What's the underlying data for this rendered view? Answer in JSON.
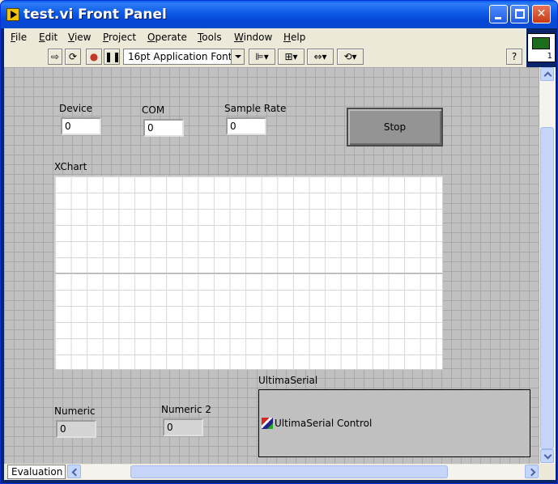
{
  "window": {
    "title": "test.vi Front Panel"
  },
  "menu": {
    "items": [
      {
        "first": "F",
        "rest": "ile"
      },
      {
        "first": "E",
        "rest": "dit"
      },
      {
        "first": "V",
        "rest": "iew"
      },
      {
        "first": "P",
        "rest": "roject"
      },
      {
        "first": "O",
        "rest": "perate"
      },
      {
        "first": "T",
        "rest": "ools"
      },
      {
        "first": "W",
        "rest": "indow"
      },
      {
        "first": "H",
        "rest": "elp"
      }
    ]
  },
  "toolbar": {
    "font_select": "16pt Application Font",
    "help_label": "?"
  },
  "vi_icon": {
    "number": "1"
  },
  "controls": {
    "device": {
      "label": "Device",
      "value": "0"
    },
    "com": {
      "label": "COM",
      "value": "0"
    },
    "sample_rate": {
      "label": "Sample Rate",
      "value": "0"
    },
    "stop": {
      "label": "Stop"
    },
    "xchart": {
      "label": "XChart"
    },
    "numeric": {
      "label": "Numeric",
      "value": "0"
    },
    "numeric2": {
      "label": "Numeric 2",
      "value": "0"
    },
    "ultimaserial": {
      "label": "UltimaSerial",
      "content": "UltimaSerial Control"
    }
  },
  "status": {
    "tab": "Evaluation"
  }
}
